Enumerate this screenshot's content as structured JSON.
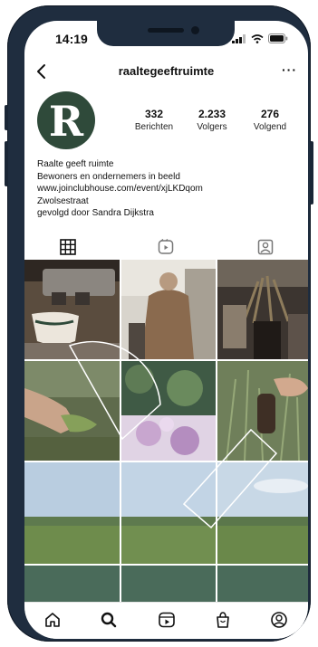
{
  "status_bar": {
    "time": "14:19"
  },
  "header": {
    "username": "raaltegeeftruimte",
    "more_label": "···"
  },
  "profile": {
    "avatar_letter": "R",
    "avatar_color": "#2f4a3a",
    "stats": [
      {
        "value": "332",
        "label": "Berichten"
      },
      {
        "value": "2.233",
        "label": "Volgers"
      },
      {
        "value": "276",
        "label": "Volgend"
      }
    ],
    "bio": {
      "name": "Raalte geeft ruimte",
      "tagline": "Bewoners en ondernemers in beeld",
      "link": "www.joinclubhouse.com/event/xjLKDqom",
      "location": "Zwolsestraat",
      "followed_by": "gevolgd door Sandra Dijkstra"
    }
  },
  "tabs": [
    {
      "icon": "grid-icon",
      "active": true
    },
    {
      "icon": "reels-icon",
      "active": false
    },
    {
      "icon": "tagged-icon",
      "active": false
    }
  ],
  "grid_posts": [
    {
      "subject": "coffee-machine"
    },
    {
      "subject": "person-in-shop"
    },
    {
      "subject": "interior-plants"
    },
    {
      "subject": "hand-in-plants"
    },
    {
      "subject": "flowers"
    },
    {
      "subject": "hand-holding-plant"
    },
    {
      "subject": "green-field"
    },
    {
      "subject": "green-field"
    },
    {
      "subject": "green-field"
    },
    {
      "subject": "green-tile"
    },
    {
      "subject": "green-tile"
    },
    {
      "subject": "green-tile"
    }
  ],
  "bottom_nav": [
    {
      "icon": "home-icon"
    },
    {
      "icon": "search-icon"
    },
    {
      "icon": "reels-nav-icon"
    },
    {
      "icon": "shop-icon"
    },
    {
      "icon": "profile-icon"
    }
  ],
  "colors": {
    "frame": "#1f2d3f",
    "brand_green": "#2f4a3a",
    "tile_green": "#4a6b5a"
  }
}
